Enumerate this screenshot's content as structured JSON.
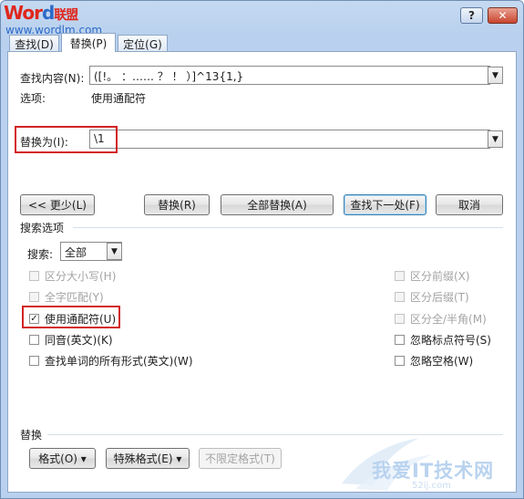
{
  "watermark": {
    "logo_word_prefix": "Wor",
    "logo_word_suffix": "d",
    "logo_small": "联盟",
    "logo_cn": "联盟",
    "url": "www.wordlm.com",
    "bottom_text": "我爱IT技术网",
    "bottom_url": "52ij.com"
  },
  "titlebar": {
    "help_glyph": "?",
    "close_glyph": "✕"
  },
  "tabs": [
    {
      "label": "查找(D)",
      "active": false
    },
    {
      "label": "替换(P)",
      "active": true
    },
    {
      "label": "定位(G)",
      "active": false
    }
  ],
  "find": {
    "label": "查找内容(N):",
    "value": "([!。 ：…… ？ ！ ）]^13{1,}",
    "options_label": "选项:",
    "options_value": "使用通配符"
  },
  "replace": {
    "label": "替换为(I):",
    "value": "\\1"
  },
  "buttons": {
    "less": "<< 更少(L)",
    "replace": "替换(R)",
    "replace_all": "全部替换(A)",
    "find_next": "查找下一处(F)",
    "cancel": "取消"
  },
  "search_options": {
    "title": "搜索选项",
    "search_label": "搜索:",
    "search_value": "全部"
  },
  "checkboxes_left": [
    {
      "label": "区分大小写(H)",
      "checked": false,
      "disabled": true
    },
    {
      "label": "全字匹配(Y)",
      "checked": false,
      "disabled": true
    },
    {
      "label": "使用通配符(U)",
      "checked": true,
      "disabled": false
    },
    {
      "label": "同音(英文)(K)",
      "checked": false,
      "disabled": false
    },
    {
      "label": "查找单词的所有形式(英文)(W)",
      "checked": false,
      "disabled": false
    }
  ],
  "checkboxes_right": [
    {
      "label": "区分前缀(X)",
      "checked": false,
      "disabled": true
    },
    {
      "label": "区分后缀(T)",
      "checked": false,
      "disabled": true
    },
    {
      "label": "区分全/半角(M)",
      "checked": false,
      "disabled": true
    },
    {
      "label": "忽略标点符号(S)",
      "checked": false,
      "disabled": false
    },
    {
      "label": "忽略空格(W)",
      "checked": false,
      "disabled": false
    }
  ],
  "replace_section": {
    "title": "替换",
    "format_button": "格式(O) ▾",
    "special_button": "特殊格式(E) ▾",
    "no_format_button": "不限定格式(T)"
  },
  "colors": {
    "highlight_border": "#d22323",
    "frame": "#b9d1ee"
  }
}
